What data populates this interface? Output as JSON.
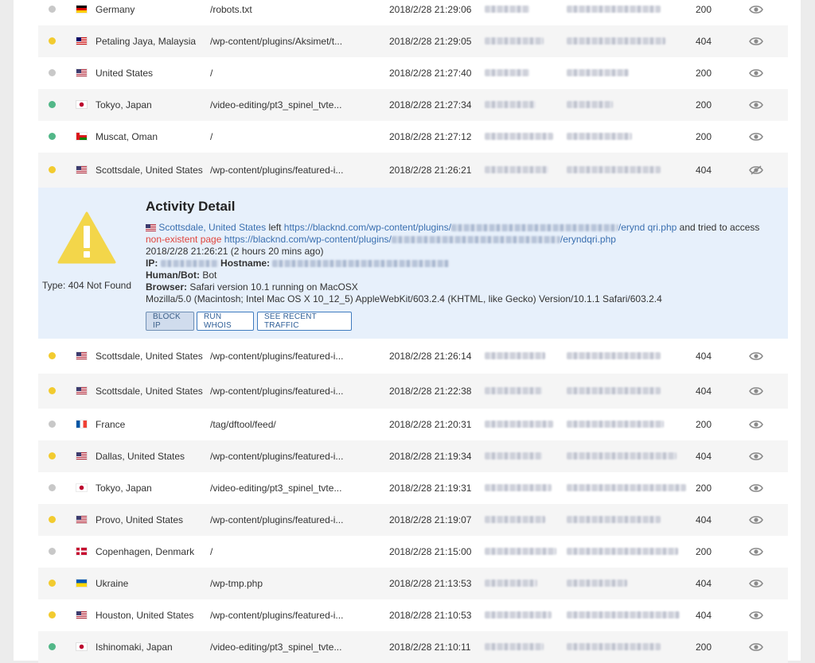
{
  "colors": {
    "dot_gray": "#c8c8c8",
    "dot_yellow": "#f2cb2f",
    "dot_green": "#52b788",
    "link": "#3a6fb0",
    "error": "#e0453d",
    "warning": "#f3d64a"
  },
  "rows_top": [
    {
      "dot": "gray",
      "flag": "de",
      "location": "Germany",
      "path": "/robots.txt",
      "time": "2018/2/28 21:29:06",
      "status": "200",
      "icon": "eye-icon"
    },
    {
      "dot": "yellow",
      "flag": "my",
      "location": "Petaling Jaya, Malaysia",
      "path": "/wp-content/plugins/Aksimet/t...",
      "time": "2018/2/28 21:29:05",
      "status": "404",
      "icon": "eye-icon"
    },
    {
      "dot": "gray",
      "flag": "us",
      "location": "United States",
      "path": "/",
      "time": "2018/2/28 21:27:40",
      "status": "200",
      "icon": "eye-icon"
    },
    {
      "dot": "green",
      "flag": "jp",
      "location": "Tokyo, Japan",
      "path": "/video-editing/pt3_spinel_tvte...",
      "time": "2018/2/28 21:27:34",
      "status": "200",
      "icon": "eye-icon"
    },
    {
      "dot": "green",
      "flag": "om",
      "location": "Muscat, Oman",
      "path": "/",
      "time": "2018/2/28 21:27:12",
      "status": "200",
      "icon": "eye-icon"
    },
    {
      "dot": "yellow",
      "flag": "us",
      "location": "Scottsdale, United States",
      "path": "/wp-content/plugins/featured-i...",
      "time": "2018/2/28 21:26:21",
      "status": "404",
      "icon": "eye-slash-icon"
    }
  ],
  "detail": {
    "title": "Activity Detail",
    "type_label": "Type: 404 Not Found",
    "location_link": "Scottsdale, United States",
    "left_text": "left",
    "left_url_prefix": "https://blacknd.com/wp-content/plugins/",
    "left_url_suffix": "/erynd qri.php",
    "tried_text": "and tried to access",
    "nonexistent": "non-existent page",
    "target_url_prefix": "https://blacknd.com/wp-content/plugins/",
    "target_url_suffix": "/eryndqri.php",
    "timestamp": "2018/2/28 21:26:21 (2 hours 20 mins ago)",
    "ip_label": "IP:",
    "hostname_label": "Hostname:",
    "humanbot_label": "Human/Bot:",
    "humanbot_value": "Bot",
    "browser_label": "Browser:",
    "browser_value": "Safari version 10.1 running on MacOSX",
    "user_agent": "Mozilla/5.0 (Macintosh; Intel Mac OS X 10_12_5) AppleWebKit/603.2.4 (KHTML, like Gecko) Version/10.1.1 Safari/603.2.4",
    "buttons": {
      "block_ip": "BLOCK IP",
      "run_whois": "RUN WHOIS",
      "see_traffic": "SEE RECENT TRAFFIC"
    }
  },
  "rows_bottom": [
    {
      "dot": "yellow",
      "flag": "us",
      "location": "Scottsdale, United States",
      "path": "/wp-content/plugins/featured-i...",
      "time": "2018/2/28 21:26:14",
      "status": "404",
      "icon": "eye-icon"
    },
    {
      "dot": "yellow",
      "flag": "us",
      "location": "Scottsdale, United States",
      "path": "/wp-content/plugins/featured-i...",
      "time": "2018/2/28 21:22:38",
      "status": "404",
      "icon": "eye-icon"
    },
    {
      "dot": "gray",
      "flag": "fr",
      "location": "France",
      "path": "/tag/dftool/feed/",
      "time": "2018/2/28 21:20:31",
      "status": "200",
      "icon": "eye-icon"
    },
    {
      "dot": "yellow",
      "flag": "us",
      "location": "Dallas, United States",
      "path": "/wp-content/plugins/featured-i...",
      "time": "2018/2/28 21:19:34",
      "status": "404",
      "icon": "eye-icon"
    },
    {
      "dot": "gray",
      "flag": "jp",
      "location": "Tokyo, Japan",
      "path": "/video-editing/pt3_spinel_tvte...",
      "time": "2018/2/28 21:19:31",
      "status": "200",
      "icon": "eye-icon"
    },
    {
      "dot": "yellow",
      "flag": "us",
      "location": "Provo, United States",
      "path": "/wp-content/plugins/featured-i...",
      "time": "2018/2/28 21:19:07",
      "status": "404",
      "icon": "eye-icon"
    },
    {
      "dot": "gray",
      "flag": "dk",
      "location": "Copenhagen, Denmark",
      "path": "/",
      "time": "2018/2/28 21:15:00",
      "status": "200",
      "icon": "eye-icon"
    },
    {
      "dot": "yellow",
      "flag": "ua",
      "location": "Ukraine",
      "path": "/wp-tmp.php",
      "time": "2018/2/28 21:13:53",
      "status": "404",
      "icon": "eye-icon"
    },
    {
      "dot": "yellow",
      "flag": "us",
      "location": "Houston, United States",
      "path": "/wp-content/plugins/featured-i...",
      "time": "2018/2/28 21:10:53",
      "status": "404",
      "icon": "eye-icon"
    },
    {
      "dot": "green",
      "flag": "jp",
      "location": "Ishinomaki, Japan",
      "path": "/video-editing/pt3_spinel_tvte...",
      "time": "2018/2/28 21:10:11",
      "status": "200",
      "icon": "eye-icon"
    }
  ]
}
